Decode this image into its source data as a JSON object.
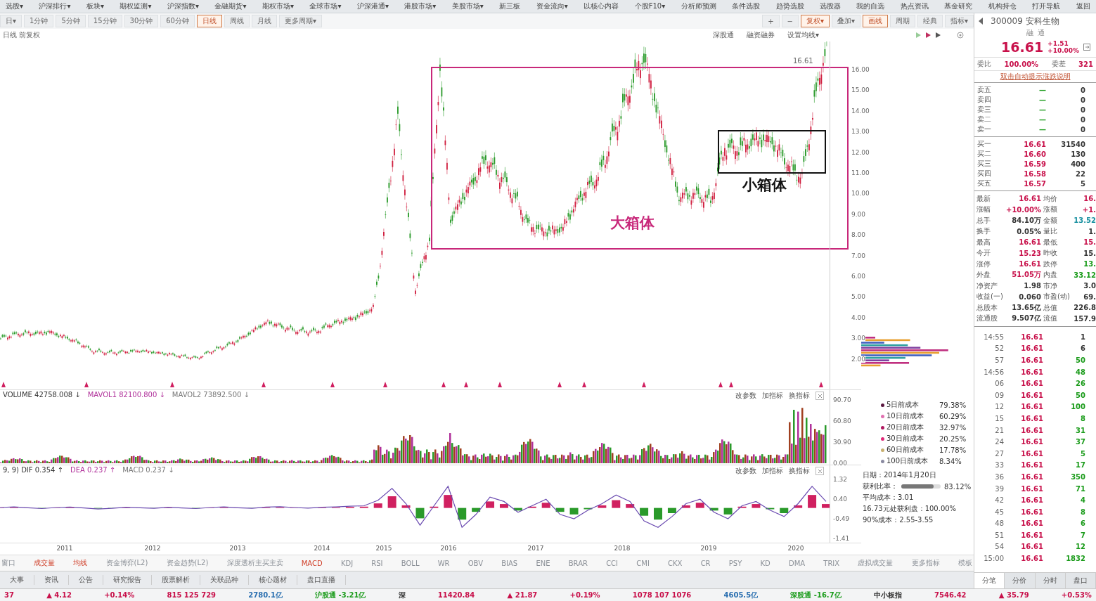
{
  "menu": [
    "选股▾",
    "沪深排行▾",
    "板块▾",
    "期权监测▾",
    "沪深指数▾",
    "金融期货▾",
    "期权市场▾",
    "全球市场▾",
    "沪深港通▾",
    "港股市场▾",
    "美股市场▾",
    "新三板",
    "资金流向▾",
    "以核心内容",
    "个股F10▾",
    "分析师预测",
    "条件选股",
    "趋势选股",
    "选股器",
    "我的自选",
    "热点资讯",
    "基金研究",
    "机构持仓",
    "打开导航",
    "返回"
  ],
  "period_tabs": [
    {
      "label": "日▾",
      "selected": false
    },
    {
      "label": "1分钟",
      "selected": false
    },
    {
      "label": "5分钟",
      "selected": false
    },
    {
      "label": "15分钟",
      "selected": false
    },
    {
      "label": "30分钟",
      "selected": false
    },
    {
      "label": "60分钟",
      "selected": false
    },
    {
      "label": "日线",
      "selected": true
    },
    {
      "label": "周线",
      "selected": false
    },
    {
      "label": "月线",
      "selected": false
    },
    {
      "label": "更多周期▾",
      "selected": false
    }
  ],
  "chart_tools": [
    {
      "label": "+",
      "active": false
    },
    {
      "label": "−",
      "active": false
    },
    {
      "label": "复权▾",
      "active": true
    },
    {
      "label": "叠加▾",
      "active": false
    },
    {
      "label": "画线",
      "active": true
    },
    {
      "label": "周期",
      "active": false
    },
    {
      "label": "经典",
      "active": false
    },
    {
      "label": "指标▾",
      "active": false
    }
  ],
  "info_line": "日线 前复权",
  "chart_links": [
    "深股通",
    "融资融券",
    "设置均线▾"
  ],
  "price_axis": [
    "16.00",
    "15.00",
    "14.00",
    "13.00",
    "12.00",
    "11.00",
    "10.00",
    "9.00",
    "8.00",
    "7.00",
    "6.00",
    "5.00",
    "4.00",
    "3.00",
    "2.00"
  ],
  "high_label": "16.61",
  "boxes": [
    {
      "label": "大箱体",
      "color": "#c8287a"
    },
    {
      "label": "小箱体",
      "color": "#111111"
    }
  ],
  "volume": {
    "header": [
      {
        "text": "VOLUME 42758.008 ↓",
        "color": "#333333"
      },
      {
        "text": "MAVOL1 82100.800 ↓",
        "color": "#b0309a"
      },
      {
        "text": "MAVOL2 73892.500 ↓",
        "color": "#777777"
      }
    ],
    "tools": [
      "改参数",
      "加指标",
      "换指标"
    ],
    "axis": [
      "90.70",
      "60.80",
      "30.90",
      "0.00"
    ]
  },
  "macd": {
    "header": [
      {
        "text": "9, 9) DIF 0.354 ↑",
        "color": "#333333"
      },
      {
        "text": "DEA 0.237 ↑",
        "color": "#b0309a"
      },
      {
        "text": "MACD 0.237 ↓",
        "color": "#777777"
      }
    ],
    "tools": [
      "改参数",
      "加指标",
      "换指标"
    ],
    "chart_data": {
      "type": "line",
      "ylim": [
        -1.41,
        1.32
      ],
      "yticks": [
        {
          "value": 1.32,
          "label": "1.32"
        },
        {
          "value": 0.4,
          "label": "0.40"
        },
        {
          "value": -0.49,
          "label": "-0.49"
        },
        {
          "value": -1.41,
          "label": "-1.41"
        }
      ],
      "series": [
        {
          "color": "#6a4ab0",
          "values": [
            0.02,
            0.05,
            0.01,
            -0.03,
            0.02,
            0.04,
            0.0,
            -0.05,
            -0.02,
            0.03,
            0.01,
            -0.02,
            0.03,
            0.0,
            -0.03,
            0.02,
            0.05,
            0.01,
            -0.02,
            0.04,
            0.06,
            0.02,
            -0.01,
            0.03,
            0.05,
            0.08,
            0.1,
            0.35,
            0.9,
            0.2,
            -0.8,
            0.1,
            1.0,
            -0.9,
            -0.3,
            0.5,
            0.3,
            -0.2,
            0.1,
            0.4,
            -0.3,
            -0.5,
            -0.1,
            0.2,
            0.6,
            0.3,
            -0.6,
            -0.9,
            -0.4,
            0.2,
            0.4,
            -0.2,
            -0.5,
            0.1,
            0.3,
            -0.1,
            -0.4,
            0.2,
            1.0,
            0.3
          ]
        }
      ]
    }
  },
  "years": [
    "2011",
    "2012",
    "2013",
    "2014",
    "2015",
    "2016",
    "2017",
    "2018",
    "2019",
    "2020"
  ],
  "cost_legend": [
    {
      "label": "5日前成本",
      "value": "79.38%",
      "color": "#5a1840"
    },
    {
      "label": "10日前成本",
      "value": "60.29%",
      "color": "#e070b0"
    },
    {
      "label": "20日前成本",
      "value": "32.97%",
      "color": "#b01860"
    },
    {
      "label": "30日前成本",
      "value": "20.25%",
      "color": "#e02878"
    },
    {
      "label": "60日前成本",
      "value": "17.78%",
      "color": "#c8b070"
    },
    {
      "label": "100日前成本",
      "value": "8.34%",
      "color": "#8a8aa0"
    }
  ],
  "chip_info": {
    "date": "日期：2014年1月20日",
    "ratio_label": "获利比率：",
    "ratio": "83.12%",
    "level": 0.83,
    "lines": [
      "平均成本：3.01",
      "16.73元处获利盘：100.00%",
      "90%成本：2.55-3.55"
    ]
  },
  "indicator_tabs": [
    {
      "label": "窗口",
      "selected": false
    },
    {
      "label": "成交量",
      "selected": true
    },
    {
      "label": "均线",
      "selected": true
    },
    {
      "label": "资金博弈(L2)",
      "selected": false
    },
    {
      "label": "资金趋势(L2)",
      "selected": false
    },
    {
      "label": "深度透析主买主卖",
      "selected": false
    },
    {
      "label": "MACD",
      "selected": true
    },
    {
      "label": "KDJ",
      "selected": false
    },
    {
      "label": "RSI",
      "selected": false
    },
    {
      "label": "BOLL",
      "selected": false
    },
    {
      "label": "WR",
      "selected": false
    },
    {
      "label": "OBV",
      "selected": false
    },
    {
      "label": "BIAS",
      "selected": false
    },
    {
      "label": "ENE",
      "selected": false
    },
    {
      "label": "BRAR",
      "selected": false
    },
    {
      "label": "CCI",
      "selected": false
    },
    {
      "label": "CMI",
      "selected": false
    },
    {
      "label": "CKX",
      "selected": false
    },
    {
      "label": "CR",
      "selected": false
    },
    {
      "label": "PSY",
      "selected": false
    },
    {
      "label": "KD",
      "selected": false
    },
    {
      "label": "DMA",
      "selected": false
    },
    {
      "label": "TRIX",
      "selected": false
    },
    {
      "label": "虚拟成交量",
      "selected": false
    },
    {
      "label": "更多指标",
      "selected": false
    },
    {
      "label": "模板",
      "selected": false
    }
  ],
  "bottom_tabs": [
    "大事",
    "资讯",
    "公告",
    "研究报告",
    "股票解析",
    "关联品种",
    "核心题材",
    "盘口直播"
  ],
  "quote": {
    "title": "300009 安科生物",
    "tags": [
      "融",
      "通"
    ],
    "price": "16.61",
    "change": "+1.51",
    "change_pct": "+10.00%",
    "ratio": [
      {
        "label": "委比",
        "value": "100.00%",
        "color": "#c8104a"
      },
      {
        "label": "委差",
        "value": "321",
        "color": "#c8104a"
      }
    ],
    "hint": "双击自动提示涨跌说明",
    "sells": [
      {
        "label": "卖五",
        "price": "—",
        "volume": "0"
      },
      {
        "label": "卖四",
        "price": "—",
        "volume": "0"
      },
      {
        "label": "卖三",
        "price": "—",
        "volume": "0"
      },
      {
        "label": "卖二",
        "price": "—",
        "volume": "0"
      },
      {
        "label": "卖一",
        "price": "—",
        "volume": "0"
      }
    ],
    "buys": [
      {
        "label": "买一",
        "price": "16.61",
        "volume": "31540"
      },
      {
        "label": "买二",
        "price": "16.60",
        "volume": "130"
      },
      {
        "label": "买三",
        "price": "16.59",
        "volume": "400"
      },
      {
        "label": "买四",
        "price": "16.58",
        "volume": "22"
      },
      {
        "label": "买五",
        "price": "16.57",
        "volume": "5"
      }
    ],
    "stats": [
      {
        "left": {
          "label": "最新",
          "value": "16.61",
          "color": "#c8104a"
        },
        "right": {
          "label": "均价",
          "value": "16.",
          "color": "#c8104a"
        }
      },
      {
        "left": {
          "label": "涨幅",
          "value": "+10.00%",
          "color": "#c8104a"
        },
        "right": {
          "label": "涨额",
          "value": "+1.",
          "color": "#c8104a"
        }
      },
      {
        "left": {
          "label": "总手",
          "value": "84.10万",
          "color": "#333333"
        },
        "right": {
          "label": "金额",
          "value": "13.52",
          "color": "#1890a0"
        }
      },
      {
        "left": {
          "label": "换手",
          "value": "0.05%",
          "color": "#333333"
        },
        "right": {
          "label": "量比",
          "value": "1.",
          "color": "#333333"
        }
      },
      {
        "left": {
          "label": "最高",
          "value": "16.61",
          "color": "#c8104a"
        },
        "right": {
          "label": "最低",
          "value": "15.",
          "color": "#c8104a"
        }
      },
      {
        "left": {
          "label": "今开",
          "value": "15.23",
          "color": "#c8104a"
        },
        "right": {
          "label": "昨收",
          "value": "15.",
          "color": "#333333"
        }
      },
      {
        "left": {
          "label": "涨停",
          "value": "16.61",
          "color": "#c8104a"
        },
        "right": {
          "label": "跌停",
          "value": "13.",
          "color": "#1a9b1a"
        }
      },
      {
        "left": {
          "label": "外盘",
          "value": "51.05万",
          "color": "#c8104a"
        },
        "right": {
          "label": "内盘",
          "value": "33.12",
          "color": "#1a9b1a"
        }
      },
      {
        "left": {
          "label": "净资产",
          "value": "1.98",
          "color": "#333333"
        },
        "right": {
          "label": "市净",
          "value": "3.0",
          "color": "#333333"
        }
      },
      {
        "left": {
          "label": "收益(一)",
          "value": "0.060",
          "color": "#333333"
        },
        "right": {
          "label": "市盈(动)",
          "value": "69.",
          "color": "#333333"
        }
      },
      {
        "left": {
          "label": "总股本",
          "value": "13.65亿",
          "color": "#333333"
        },
        "right": {
          "label": "总值",
          "value": "226.8",
          "color": "#333333"
        }
      },
      {
        "left": {
          "label": "流通股",
          "value": "9.507亿",
          "color": "#333333"
        },
        "right": {
          "label": "流值",
          "value": "157.9",
          "color": "#333333"
        }
      }
    ],
    "ticks": [
      {
        "time": "14:55",
        "price": "16.61",
        "volume": "1",
        "color": "#333333"
      },
      {
        "time": "52",
        "price": "16.61",
        "volume": "6",
        "color": "#333333"
      },
      {
        "time": "57",
        "price": "16.61",
        "volume": "50",
        "color": "#1a9b1a"
      },
      {
        "time": "14:56",
        "price": "16.61",
        "volume": "48",
        "color": "#1a9b1a"
      },
      {
        "time": "06",
        "price": "16.61",
        "volume": "26",
        "color": "#1a9b1a"
      },
      {
        "time": "09",
        "price": "16.61",
        "volume": "50",
        "color": "#1a9b1a"
      },
      {
        "time": "12",
        "price": "16.61",
        "volume": "100",
        "color": "#1a9b1a"
      },
      {
        "time": "15",
        "price": "16.61",
        "volume": "8",
        "color": "#1a9b1a"
      },
      {
        "time": "21",
        "price": "16.61",
        "volume": "31",
        "color": "#1a9b1a"
      },
      {
        "time": "24",
        "price": "16.61",
        "volume": "37",
        "color": "#1a9b1a"
      },
      {
        "time": "27",
        "price": "16.61",
        "volume": "5",
        "color": "#1a9b1a"
      },
      {
        "time": "33",
        "price": "16.61",
        "volume": "17",
        "color": "#1a9b1a"
      },
      {
        "time": "36",
        "price": "16.61",
        "volume": "350",
        "color": "#1a9b1a"
      },
      {
        "time": "39",
        "price": "16.61",
        "volume": "71",
        "color": "#1a9b1a"
      },
      {
        "time": "42",
        "price": "16.61",
        "volume": "4",
        "color": "#1a9b1a"
      },
      {
        "time": "45",
        "price": "16.61",
        "volume": "8",
        "color": "#1a9b1a"
      },
      {
        "time": "48",
        "price": "16.61",
        "volume": "6",
        "color": "#1a9b1a"
      },
      {
        "time": "51",
        "price": "16.61",
        "volume": "7",
        "color": "#1a9b1a"
      },
      {
        "time": "54",
        "price": "16.61",
        "volume": "12",
        "color": "#1a9b1a"
      },
      {
        "time": "15:00",
        "price": "16.61",
        "volume": "1832",
        "color": "#1a9b1a"
      }
    ],
    "tabs": [
      {
        "label": "分笔",
        "selected": true
      },
      {
        "label": "分价",
        "selected": false
      },
      {
        "label": "分时",
        "selected": false
      },
      {
        "label": "盘口",
        "selected": false
      }
    ]
  },
  "status_bar": [
    {
      "text": "37",
      "color": "#c8104a"
    },
    {
      "text": "▲ 4.12",
      "color": "#c8104a"
    },
    {
      "text": "+0.14%",
      "color": "#c8104a"
    },
    {
      "text": "815 125 729",
      "color": "#c8104a"
    },
    {
      "text": "2780.1亿",
      "color": "#2a6fb0"
    },
    {
      "text": "沪股通 -3.21亿",
      "color": "#1a9b1a"
    },
    {
      "text": "深",
      "color": "#333333"
    },
    {
      "text": "11420.84",
      "color": "#c8104a"
    },
    {
      "text": "▲ 21.87",
      "color": "#c8104a"
    },
    {
      "text": "+0.19%",
      "color": "#c8104a"
    },
    {
      "text": "1078 107 1076",
      "color": "#c8104a"
    },
    {
      "text": "4605.5亿",
      "color": "#2a6fb0"
    },
    {
      "text": "深股通 -16.7亿",
      "color": "#1a9b1a"
    },
    {
      "text": "中小板指",
      "color": "#333333"
    },
    {
      "text": "7546.42",
      "color": "#c8104a"
    },
    {
      "text": "▲ 35.79",
      "color": "#c8104a"
    },
    {
      "text": "+0.53%",
      "color": "#c8104a"
    }
  ]
}
